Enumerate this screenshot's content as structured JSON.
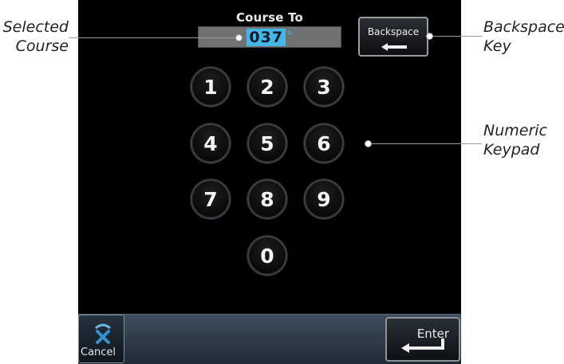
{
  "screen": {
    "title": "Course To",
    "course_value": "037",
    "course_unit": "°"
  },
  "keypad": {
    "keys": [
      "1",
      "2",
      "3",
      "4",
      "5",
      "6",
      "7",
      "8",
      "9",
      "0"
    ]
  },
  "buttons": {
    "backspace_label": "Backspace",
    "cancel_label": "Cancel",
    "enter_label": "Enter"
  },
  "callouts": {
    "selected_course_line1": "Selected",
    "selected_course_line2": "Course",
    "backspace_key_line1": "Backspace",
    "backspace_key_line2": "Key",
    "numeric_keypad_line1": "Numeric",
    "numeric_keypad_line2": "Keypad"
  },
  "icons": {
    "backspace": "left-arrow-icon",
    "cancel": "cancel-x-icon",
    "enter": "enter-return-icon"
  },
  "colors": {
    "accent": "#45b7e6",
    "screen_background": "#000000",
    "bar_background": "#2f3d4a"
  }
}
